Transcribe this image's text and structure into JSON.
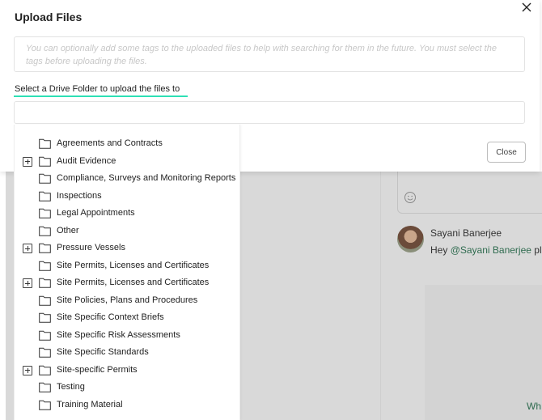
{
  "modal": {
    "title": "Upload Files",
    "tags_placeholder": "You can optionally add some tags to the uploaded files to help with searching for them in the future. You must select the tags before uploading the files.",
    "folder_label": "Select a Drive Folder to upload the files to",
    "folder_value": "",
    "close_button": "Close",
    "accent_color": "#2ee0b5"
  },
  "folders": [
    {
      "label": "Agreements and Contracts",
      "expandable": false
    },
    {
      "label": "Audit Evidence",
      "expandable": true
    },
    {
      "label": "Compliance, Surveys and Monitoring Reports",
      "expandable": false
    },
    {
      "label": "Inspections",
      "expandable": false
    },
    {
      "label": "Legal Appointments",
      "expandable": false
    },
    {
      "label": "Other",
      "expandable": false
    },
    {
      "label": "Pressure Vessels",
      "expandable": true
    },
    {
      "label": "Site Permits, Licenses and Certificates",
      "expandable": false
    },
    {
      "label": "Site Permits, Licenses and Certificates",
      "expandable": true
    },
    {
      "label": "Site Policies, Plans and Procedures",
      "expandable": false
    },
    {
      "label": "Site Specific Context Briefs",
      "expandable": false
    },
    {
      "label": "Site Specific Risk Assessments",
      "expandable": false
    },
    {
      "label": "Site Specific Standards",
      "expandable": false
    },
    {
      "label": "Site-specific Permits",
      "expandable": true
    },
    {
      "label": "Testing",
      "expandable": false
    },
    {
      "label": "Training Material",
      "expandable": false
    }
  ],
  "background": {
    "commenter_name": "Sayani Banerjee",
    "message_prefix": "Hey ",
    "mention": "@Sayani Banerjee",
    "message_suffix": " pleas",
    "partial_text": "Wh"
  }
}
